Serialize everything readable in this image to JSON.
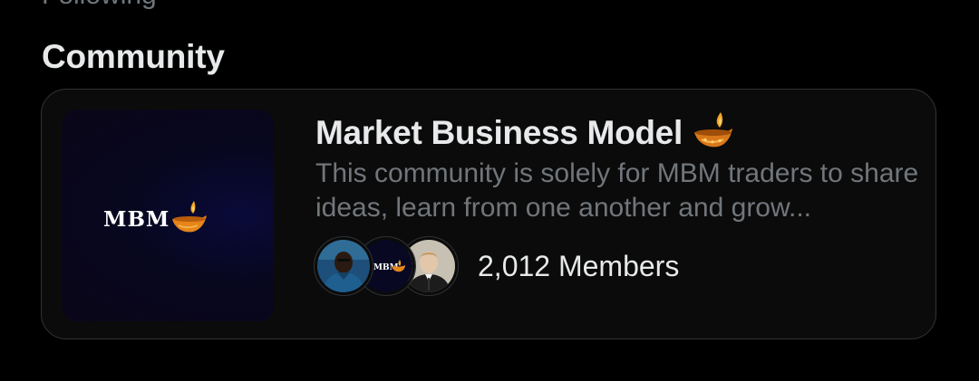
{
  "section": {
    "previous_line": "Following",
    "title": "Community"
  },
  "community": {
    "cover": {
      "logo_text": "MBM",
      "logo_icon": "diya-lamp-icon"
    },
    "name": "Market Business Model",
    "name_emoji": "diya-lamp-icon",
    "description": "This community is solely for MBM traders to share ideas, learn from one another and grow...",
    "member_avatars": [
      "member-avatar-man",
      "member-avatar-mbm-logo",
      "member-avatar-suit"
    ],
    "members_label": "2,012 Members"
  },
  "colors": {
    "background": "#000000",
    "card_background": "#0b0b0b",
    "card_border": "#2f3336",
    "primary_text": "#e7e9ea",
    "secondary_text": "#71767b",
    "lamp_flame": "#f5a623"
  }
}
